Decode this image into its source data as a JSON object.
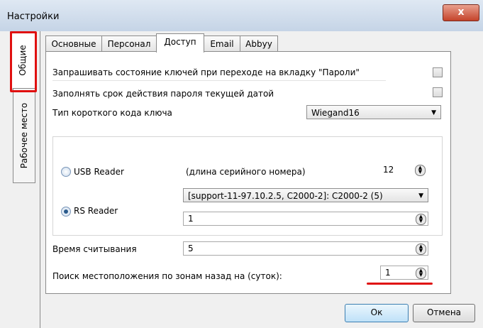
{
  "window": {
    "title": "Настройки",
    "close_glyph": "x"
  },
  "side_tabs": [
    {
      "label": "Общие",
      "active": true,
      "highlighted": true
    },
    {
      "label": "Рабочее место",
      "active": false
    }
  ],
  "tabs": [
    {
      "label": "Основные"
    },
    {
      "label": "Персонал"
    },
    {
      "label": "Доступ",
      "active": true
    },
    {
      "label": "Email"
    },
    {
      "label": "Abbyy"
    }
  ],
  "access": {
    "check_keys_label": "Запрашивать состояние ключей при переходе на вкладку \"Пароли\"",
    "check_keys_checked": false,
    "fill_expiry_label": "Заполнять срок действия пароля текущей датой",
    "fill_expiry_checked": false,
    "short_code_label": "Тип короткого кода ключа",
    "short_code_value": "Wiegand16",
    "usb_reader_label": "USB Reader",
    "usb_selected": false,
    "serial_length_label": "(длина серийного номера)",
    "serial_length_value": "12",
    "device_value": "[support-11-97.10.2.5, C2000-2]: C2000-2 (5)",
    "rs_reader_label": "RS Reader",
    "rs_selected": true,
    "rs_value": "1",
    "read_time_label": "Время считывания",
    "read_time_value": "5",
    "zone_search_label": "Поиск местоположения по зонам назад на (суток):",
    "zone_search_value": "1"
  },
  "buttons": {
    "ok": "Ок",
    "cancel": "Отмена"
  },
  "colors": {
    "highlight": "#e01010",
    "titlebar": "#c5d4e6",
    "close": "#c4432a"
  }
}
